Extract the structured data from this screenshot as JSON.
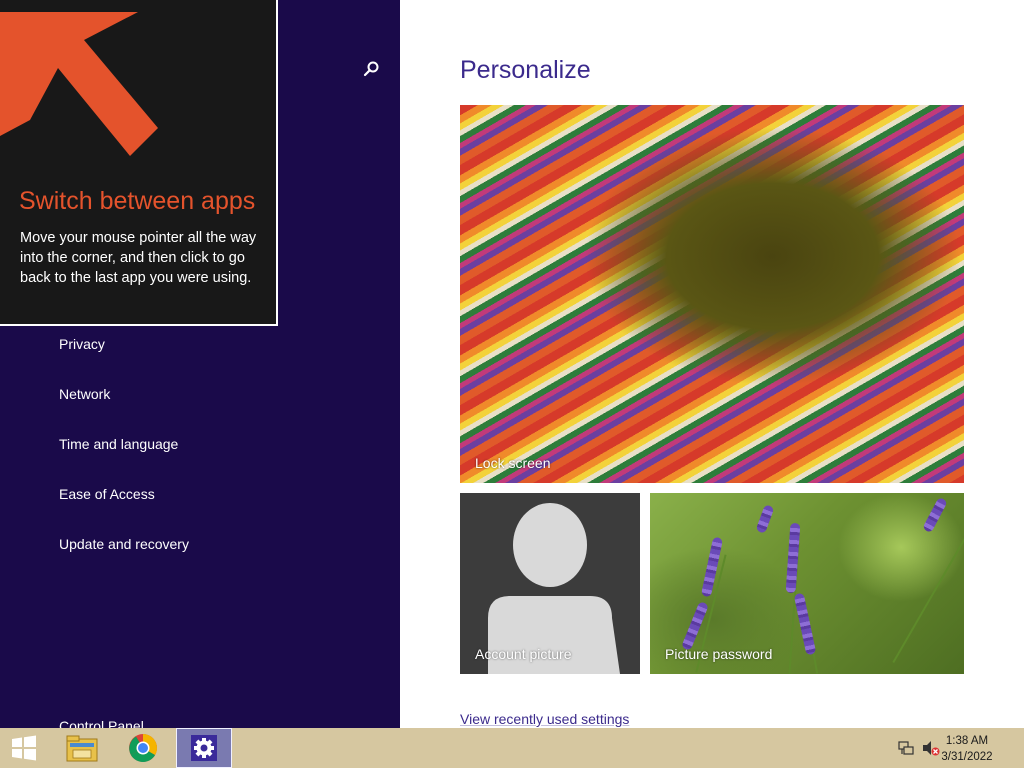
{
  "tip": {
    "title": "Switch between apps",
    "body": "Move your mouse pointer all the way into the corner, and then click to go back to the last app you were using.",
    "arrow_color": "#e4532c"
  },
  "sidebar": {
    "search_icon": "search-icon",
    "items": [
      {
        "label": "Privacy"
      },
      {
        "label": "Network"
      },
      {
        "label": "Time and language"
      },
      {
        "label": "Ease of Access"
      },
      {
        "label": "Update and recovery"
      }
    ],
    "control_panel_label": "Control Panel"
  },
  "main": {
    "title": "Personalize",
    "tiles": {
      "lock_screen": "Lock screen",
      "account_picture": "Account picture",
      "picture_password": "Picture password"
    },
    "view_recent_link": "View recently used settings"
  },
  "taskbar": {
    "apps": [
      {
        "name": "start-button",
        "icon": "windows-logo-icon"
      },
      {
        "name": "file-explorer",
        "icon": "folder-icon"
      },
      {
        "name": "chrome",
        "icon": "chrome-icon"
      },
      {
        "name": "pc-settings",
        "icon": "gear-icon",
        "active": true
      }
    ],
    "tray_icons": [
      "network-icon",
      "volume-muted-icon"
    ],
    "time": "1:38 AM",
    "date": "3/31/2022"
  },
  "colors": {
    "sidebar_bg": "#1a0a4a",
    "accent_text": "#3b2a8c",
    "taskbar_bg": "#d6c7a0"
  }
}
